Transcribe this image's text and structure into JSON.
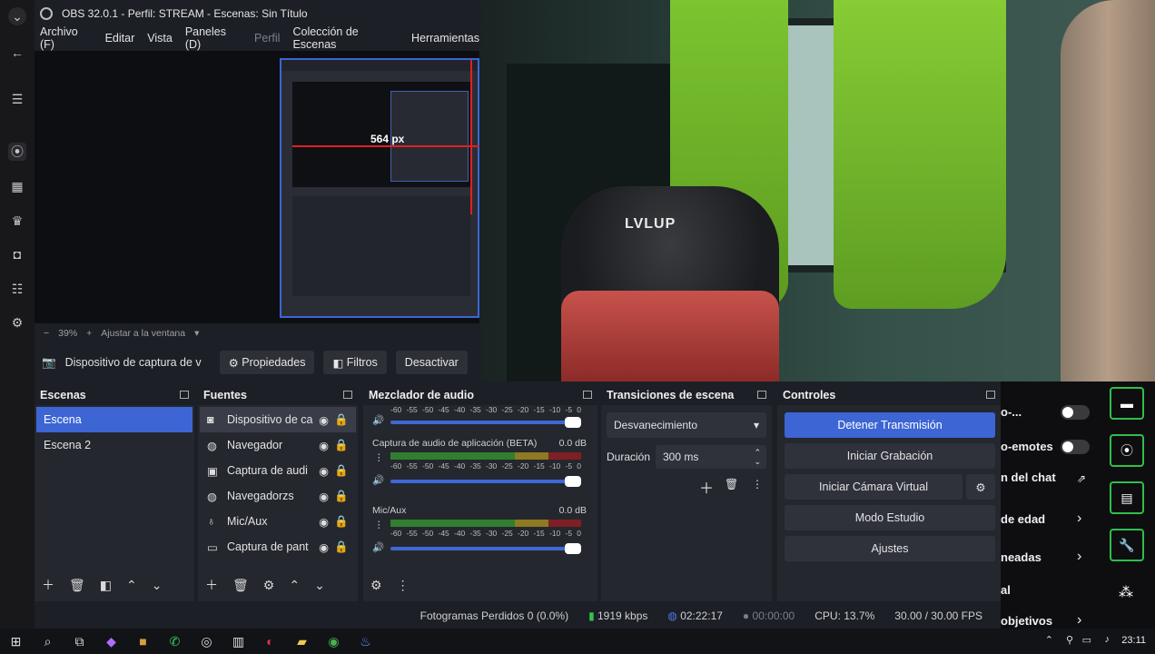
{
  "obs": {
    "title": "OBS 32.0.1 - Perfil: STREAM - Escenas: Sin Título",
    "menu": [
      "Archivo (F)",
      "Editar",
      "Vista",
      "Paneles (D)",
      "Perfil",
      "Colección de Escenas",
      "Herramientas"
    ],
    "nested_px_label": "564 px",
    "zoom": {
      "minus": "−",
      "value": "39%",
      "plus": "+",
      "fit": "Ajustar a la ventana"
    },
    "source_bar": {
      "source": "Dispositivo de captura de v",
      "properties": "Propiedades",
      "filters": "Filtros",
      "deactivate": "Desactivar"
    }
  },
  "webcam": {
    "chair_logo": "LVLUP"
  },
  "scenes": {
    "title": "Escenas",
    "items": [
      "Escena",
      "Escena 2"
    ]
  },
  "sources": {
    "title": "Fuentes",
    "items": [
      "Dispositivo de ca",
      "Navegador",
      "Captura de audi",
      "Navegadorzs",
      "Mic/Aux",
      "Captura de pant"
    ]
  },
  "mixer": {
    "title": "Mezclador de audio",
    "channels": [
      {
        "name": "",
        "db": "",
        "level": 0.0
      },
      {
        "name": "Captura de audio de aplicación (BETA)",
        "db": "0.0 dB",
        "level": 0.0
      },
      {
        "name": "Mic/Aux",
        "db": "0.0 dB",
        "level": 0.03
      }
    ],
    "ticks": [
      "-60",
      "-55",
      "-50",
      "-45",
      "-40",
      "-35",
      "-30",
      "-25",
      "-20",
      "-15",
      "-10",
      "-5",
      "0"
    ]
  },
  "transitions": {
    "title": "Transiciones de escena",
    "selected": "Desvanecimiento",
    "duration_label": "Duración",
    "duration_value": "300 ms"
  },
  "controls": {
    "title": "Controles",
    "stop_stream": "Detener Transmisión",
    "start_rec": "Iniciar Grabación",
    "virtual_cam": "Iniciar Cámara Virtual",
    "studio": "Modo Estudio",
    "settings": "Ajustes"
  },
  "status": {
    "dropped": "Fotogramas Perdidos 0 (0.0%)",
    "kbps": "1919 kbps",
    "stream_time": "02:22:17",
    "rec_time": "00:00:00",
    "cpu": "CPU: 13.7%",
    "fps": "30.00 / 30.00 FPS"
  },
  "twitch_panel": {
    "items": [
      "o-...",
      "o-emotes",
      "n del chat",
      "de edad",
      "neadas",
      "al",
      "objetivos"
    ]
  },
  "taskbar": {
    "clock": "23:11"
  }
}
